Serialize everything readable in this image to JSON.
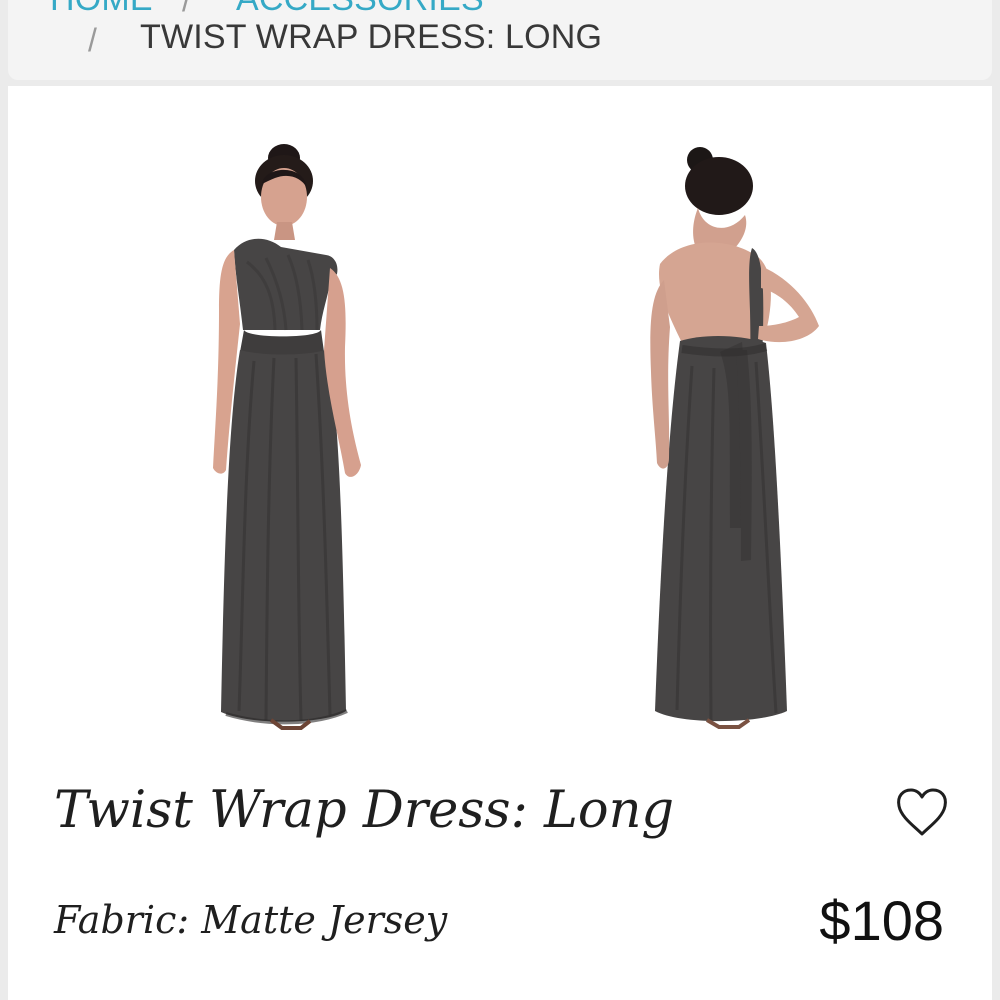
{
  "breadcrumb": {
    "items": [
      {
        "label": "HOME"
      },
      {
        "label": "ACCESSORIES"
      },
      {
        "label": "TWIST WRAP DRESS: LONG"
      }
    ],
    "separator": "/"
  },
  "product": {
    "title": "Twist Wrap Dress: Long",
    "fabric": "Fabric: Matte Jersey",
    "price": "$108",
    "wishlist_icon": "heart-outline-icon",
    "dress_color": "#474545",
    "accent_color": "#35a9c6"
  }
}
